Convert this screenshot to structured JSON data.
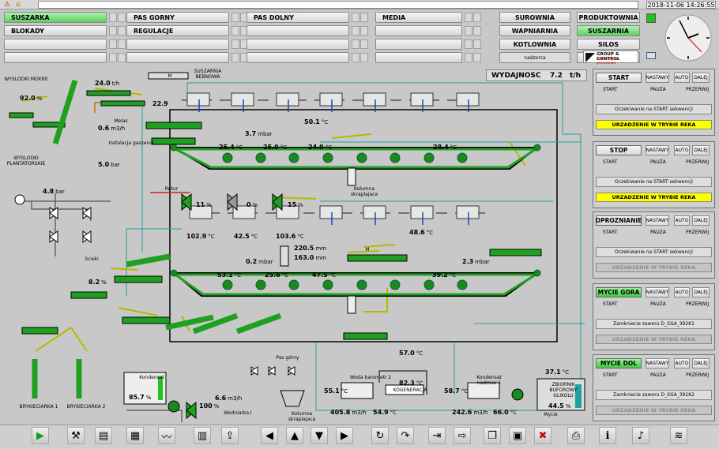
{
  "header": {
    "datetime": "2018-11-06 14:26:55"
  },
  "nav": {
    "col1": [
      "SUSZARKA",
      "BLOKADY"
    ],
    "col2": [
      "PAS GORNY",
      "REGULACJE"
    ],
    "col3": [
      "PAS DOLNY"
    ],
    "col4": [
      "MEDIA"
    ],
    "col5": [
      "SUROWNIA",
      "WAPNIARNIA",
      "KOTLOWNIA",
      "nadzorca"
    ],
    "col6": [
      "PRODUKTOWNIA",
      "SUSZARNIA",
      "SILOS"
    ]
  },
  "logo": {
    "text": "GROUP & CONTROL",
    "sub": "automatyka procesowa"
  },
  "wydajnosc": {
    "label": "WYDAJNOSC",
    "value": "7.2",
    "unit": "t/h"
  },
  "units": {
    "temp": "°C",
    "th": "t/h",
    "pct": "%",
    "mbar": "mbar",
    "bar": "bar",
    "m3h": "m3/h",
    "mm": "mm"
  },
  "process": {
    "wysl_mokre": "WYSLODKI MOKRE",
    "wysl_plant": "WYSLODKI PLANTATORSKIE",
    "suszarnia_bebnowa": "SUSZARNIA BEBNOWA",
    "v_24": "24.0",
    "p_92": "92.0",
    "p_229": "22.9",
    "melas": "Melas",
    "v_06": "0.6",
    "inst_gaszenia": "Instalacja gaszenia",
    "v_50bar": "5.0",
    "t_501": "50.1",
    "m_37": "3.7",
    "t_254": "25.4",
    "t_250": "25.0",
    "t_249": "24.9",
    "t_284": "28.4",
    "kolumna_skr": "Kolumna skraplajaca",
    "b_48": "4.8",
    "retur": "Retur",
    "pct_11": "11",
    "pct_0": "0",
    "pct_15": "15",
    "t_1029": "102.9",
    "t_425": "42.5",
    "t_1036": "103.6",
    "t_486": "48.6",
    "mm_2205": "220.5",
    "mm_1630": "163.0",
    "m_02": "0.2",
    "m_23": "2.3",
    "t_531": "53.1",
    "t_256": "25.6",
    "t_475": "47.5",
    "t_392": "39.2",
    "scieki": "Scieki",
    "p_82": "8.2",
    "brykieciarka1": "BRYKIECIARKA 1",
    "brykieciarka2": "BRYKIECIARKA 2",
    "kondensat": "Kondensat",
    "p_857": "85.7",
    "v_66": "6.6",
    "wodniarka": "Wodniarka I",
    "p_100": "100",
    "pas_gorny": "Pas górny",
    "kolumna_skr2": "Kolumna skraplajaca",
    "t_570": "57.0",
    "woda_barom": "Woda barometr 2",
    "t_551": "55.1",
    "v_4058": "405.8",
    "t_549": "54.9",
    "kogeneracja": "KOGENERACJA",
    "t_823": "82.3",
    "kondensat_nadmiar": "Kondensat nadmiar 1",
    "t_587": "58.7",
    "v_2426": "242.6",
    "t_660": "66.0",
    "mycie": "Mycie",
    "zbiornik": "ZBIORNIK BUFOROWY GLIKOLU",
    "t_371": "37.1",
    "p_445": "44.5",
    "motor": "M"
  },
  "panels": [
    {
      "title": "START",
      "msg": "Oczekiwanie na START sekwencji",
      "status": "URZADZENIE W TRYBIE REKA",
      "active": true,
      "green": false
    },
    {
      "title": "STOP",
      "msg": "Oczekiwanie na START sekwencji",
      "status": "URZADZENIE W TRYBIE REKA",
      "active": true,
      "green": false
    },
    {
      "title": "OPROZNIANIE",
      "msg": "Oczekiwanie na START sekwencji",
      "status": "URZADZENIE W TRYBIE REKA",
      "active": false,
      "green": false
    },
    {
      "title": "MYCIE GORA",
      "msg": "Zamkniecie zaworu D_GSA_392K1",
      "status": "URZADZENIE W TRYBIE REKA",
      "active": false,
      "green": true
    },
    {
      "title": "MYCIE DOL",
      "msg": "Zamkniecie zaworu D_GSA_392K2",
      "status": "URZADZENIE W TRYBIE REKA",
      "active": false,
      "green": true
    }
  ],
  "panel_labels": {
    "nastawy": "NASTAWY",
    "auto": "AUTO",
    "dalej": "DALEJ",
    "start": "START",
    "pauza": "PAUZA",
    "przerwij": "PRZERWIJ"
  },
  "toolbar": [
    "play-icon",
    "tools-icon",
    "folder-icon",
    "doc-icon",
    "trend-icon",
    "report-icon",
    "export-icon",
    "arrow-left-icon",
    "arrow-up-icon",
    "arrow-down-icon",
    "arrow-right-icon",
    "refresh-icon",
    "redo-icon",
    "import-icon",
    "forward-icon",
    "copy-icon",
    "save-icon",
    "delete-icon",
    "print-icon",
    "info-icon",
    "sound-icon",
    "signal-icon"
  ]
}
